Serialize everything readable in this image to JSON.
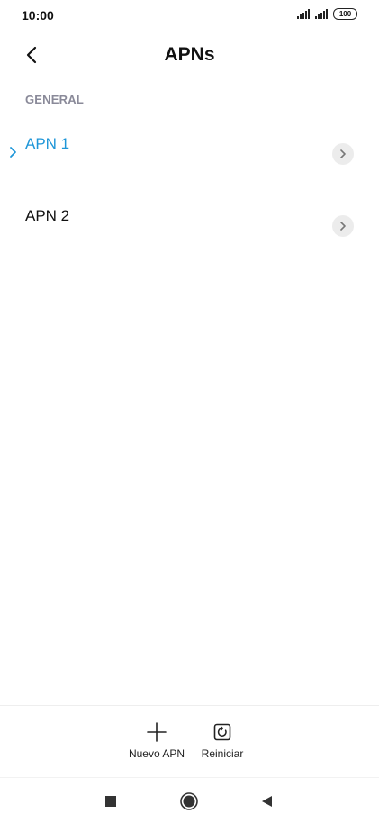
{
  "status_bar": {
    "time": "10:00",
    "battery": "100"
  },
  "header": {
    "title": "APNs"
  },
  "section": {
    "title": "GENERAL"
  },
  "apns": [
    {
      "label": "APN 1",
      "selected": true
    },
    {
      "label": "APN 2",
      "selected": false
    }
  ],
  "actions": {
    "new_apn": "Nuevo APN",
    "reset": "Reiniciar"
  },
  "colors": {
    "accent": "#1e96d8",
    "section_header": "#8a8a99",
    "chevron_bg": "#ececec"
  },
  "icons": {
    "back": "chevron-left-icon",
    "item_arrow": "chevron-right-icon",
    "selected_marker": "chevron-right-icon",
    "new_apn": "plus-icon",
    "reset": "reset-icon",
    "nav_recents": "square-icon",
    "nav_home": "circle-icon",
    "nav_back": "triangle-left-icon"
  }
}
